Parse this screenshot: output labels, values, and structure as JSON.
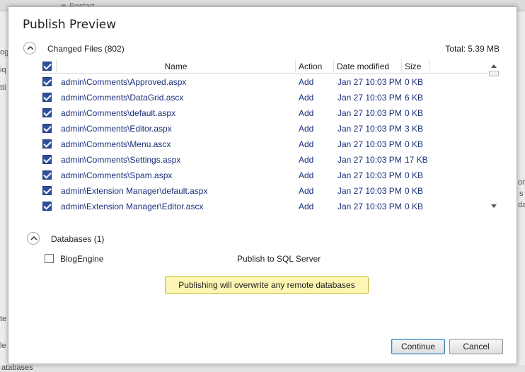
{
  "background": {
    "restart_label": "Restart",
    "side_fragments_left": [
      "og",
      "iq",
      "tti"
    ],
    "side_fragments_right": [
      "or",
      "s",
      "da"
    ],
    "bottom_left_fragments": [
      "te",
      "le"
    ],
    "databases_fragment": "atabases"
  },
  "dialog": {
    "title": "Publish Preview",
    "changed_files": {
      "label": "Changed Files (802)",
      "total": "Total: 5.39 MB",
      "columns": [
        "Name",
        "Action",
        "Date modified",
        "Size"
      ],
      "header_checked": true,
      "rows": [
        {
          "name": "admin\\Comments\\Approved.aspx",
          "action": "Add",
          "date": "Jan 27 10:03 PM",
          "size": "0 KB",
          "checked": true
        },
        {
          "name": "admin\\Comments\\DataGrid.ascx",
          "action": "Add",
          "date": "Jan 27 10:03 PM",
          "size": "6 KB",
          "checked": true
        },
        {
          "name": "admin\\Comments\\default.aspx",
          "action": "Add",
          "date": "Jan 27 10:03 PM",
          "size": "0 KB",
          "checked": true
        },
        {
          "name": "admin\\Comments\\Editor.aspx",
          "action": "Add",
          "date": "Jan 27 10:03 PM",
          "size": "3 KB",
          "checked": true
        },
        {
          "name": "admin\\Comments\\Menu.ascx",
          "action": "Add",
          "date": "Jan 27 10:03 PM",
          "size": "0 KB",
          "checked": true
        },
        {
          "name": "admin\\Comments\\Settings.aspx",
          "action": "Add",
          "date": "Jan 27 10:03 PM",
          "size": "17 KB",
          "checked": true
        },
        {
          "name": "admin\\Comments\\Spam.aspx",
          "action": "Add",
          "date": "Jan 27 10:03 PM",
          "size": "0 KB",
          "checked": true
        },
        {
          "name": "admin\\Extension Manager\\default.aspx",
          "action": "Add",
          "date": "Jan 27 10:03 PM",
          "size": "0 KB",
          "checked": true
        },
        {
          "name": "admin\\Extension Manager\\Editor.ascx",
          "action": "Add",
          "date": "Jan 27 10:03 PM",
          "size": "0 KB",
          "checked": true
        }
      ]
    },
    "databases": {
      "label": "Databases (1)",
      "db_name": "BlogEngine",
      "db_checked": false,
      "db_action": "Publish to SQL Server",
      "warning": "Publishing will overwrite any remote databases"
    },
    "buttons": {
      "continue": "Continue",
      "cancel": "Cancel"
    }
  },
  "colors": {
    "link_text": "#1a2e7a",
    "checkbox_fill": "#2d4fa0",
    "warning_bg": "#fdf5b3",
    "primary_border": "#3c7fb1"
  }
}
